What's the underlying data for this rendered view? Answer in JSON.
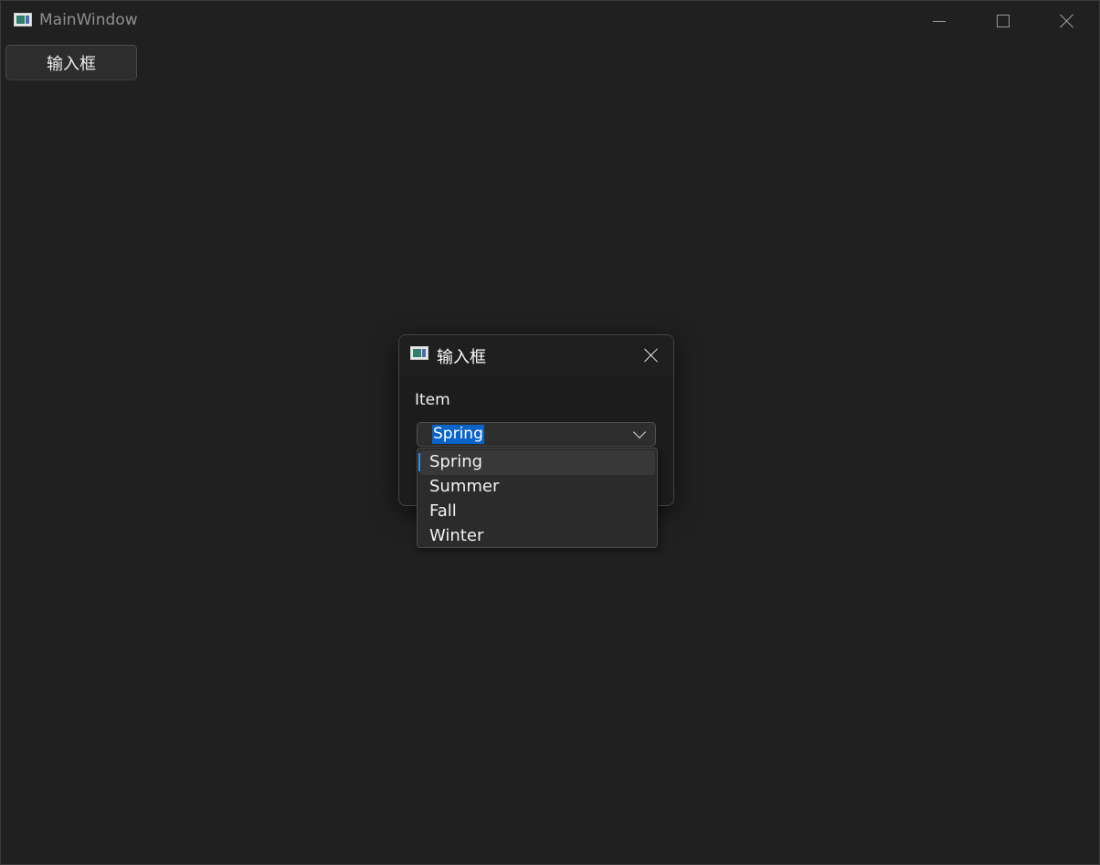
{
  "main_window": {
    "title": "MainWindow",
    "button_label": "输入框"
  },
  "dialog": {
    "title": "输入框",
    "field_label": "Item",
    "combo": {
      "value": "Spring",
      "options": [
        "Spring",
        "Summer",
        "Fall",
        "Winter"
      ],
      "selected_index": 0
    }
  },
  "colors": {
    "background": "#202020",
    "selection": "#0a64c8",
    "accent": "#2e8ee6"
  },
  "icons": [
    "app-icon",
    "minimize-icon",
    "maximize-icon",
    "close-icon",
    "chevron-down-icon"
  ]
}
